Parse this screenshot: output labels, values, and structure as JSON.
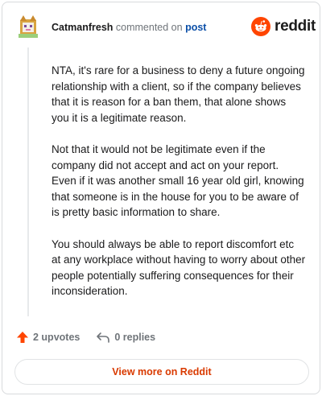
{
  "header": {
    "username": "Catmanfresh",
    "action_text": "commented on",
    "post_link": "post"
  },
  "logo": {
    "wordmark": "reddit",
    "icon": "reddit-alien-icon",
    "color": "#ff4500"
  },
  "comment": {
    "paragraphs": [
      "NTA, it's rare for a business to deny a future ongoing relationship with a client, so if the company believes that it is reason for a ban them, that alone shows you it is a legitimate reason.",
      "Not that it would not be legitimate even if the company did not accept and act on your report. Even if it was another small 16 year old girl, knowing that someone is in the house for you to be aware of is pretty basic information to share.",
      "You should always be able to report discomfort etc at any workplace without having to worry about other people potentially suffering consequences for their inconsideration."
    ]
  },
  "actions": {
    "upvotes_label": "2 upvotes",
    "replies_label": "0 replies",
    "upvote_icon": "upvote-arrow-icon",
    "reply_icon": "reply-arrow-icon"
  },
  "footer": {
    "view_more_label": "View more on Reddit"
  },
  "colors": {
    "accent": "#d93a00",
    "upvote": "#ff4500",
    "link": "#0b4fa8"
  }
}
